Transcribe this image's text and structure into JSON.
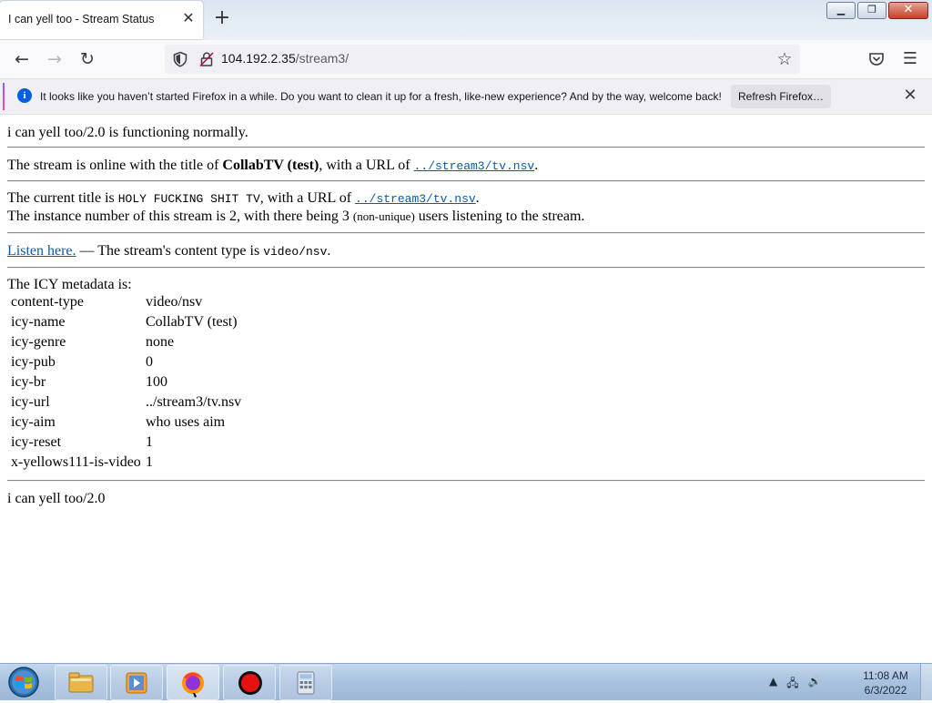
{
  "browser": {
    "tab_title": "I can yell too - Stream Status",
    "url_host": "104.192.2.35",
    "url_path": "/stream3/",
    "notice_text": "It looks like you haven’t started Firefox in a while. Do you want to clean it up for a fresh, like-new experience? And by the way, welcome back!",
    "refresh_label": "Refresh Firefox…"
  },
  "page": {
    "status_line": "i can yell too/2.0 is functioning normally.",
    "online_prefix": "The stream is online with the title of ",
    "stream_title": "CollabTV (test)",
    "online_mid": ", with a URL of ",
    "stream_url": "../stream3/tv.nsv",
    "period": ".",
    "current_prefix": "The current title is ",
    "current_title": "HOLY FUCKING SHIT TV",
    "current_mid": ", with a URL of ",
    "current_url": "../stream3/tv.nsv",
    "instance_a": "The instance number of this stream is 2, with there being 3 ",
    "instance_small": "(non-unique)",
    "instance_b": " users listening to the stream.",
    "listen_link": "Listen here.",
    "content_type_prefix": " — The stream's content type is ",
    "content_type": "video/nsv",
    "icy_heading": "The ICY metadata is:",
    "metadata": [
      {
        "key": "content-type",
        "value": "video/nsv"
      },
      {
        "key": "icy-name",
        "value": "CollabTV (test)"
      },
      {
        "key": "icy-genre",
        "value": "none"
      },
      {
        "key": "icy-pub",
        "value": "0"
      },
      {
        "key": "icy-br",
        "value": "100"
      },
      {
        "key": "icy-url",
        "value": "../stream3/tv.nsv"
      },
      {
        "key": "icy-aim",
        "value": "who uses aim"
      },
      {
        "key": "icy-reset",
        "value": "1"
      },
      {
        "key": "x-yellows111-is-video",
        "value": "1"
      }
    ],
    "footer": "i can yell too/2.0"
  },
  "taskbar": {
    "items": [
      {
        "name": "explorer",
        "icon": "folder-icon"
      },
      {
        "name": "media-player",
        "icon": "media-player-icon"
      },
      {
        "name": "firefox",
        "icon": "firefox-icon"
      },
      {
        "name": "recorder",
        "icon": "record-icon"
      },
      {
        "name": "calculator",
        "icon": "calculator-icon"
      }
    ],
    "time": "11:08 AM",
    "date": "6/3/2022"
  }
}
